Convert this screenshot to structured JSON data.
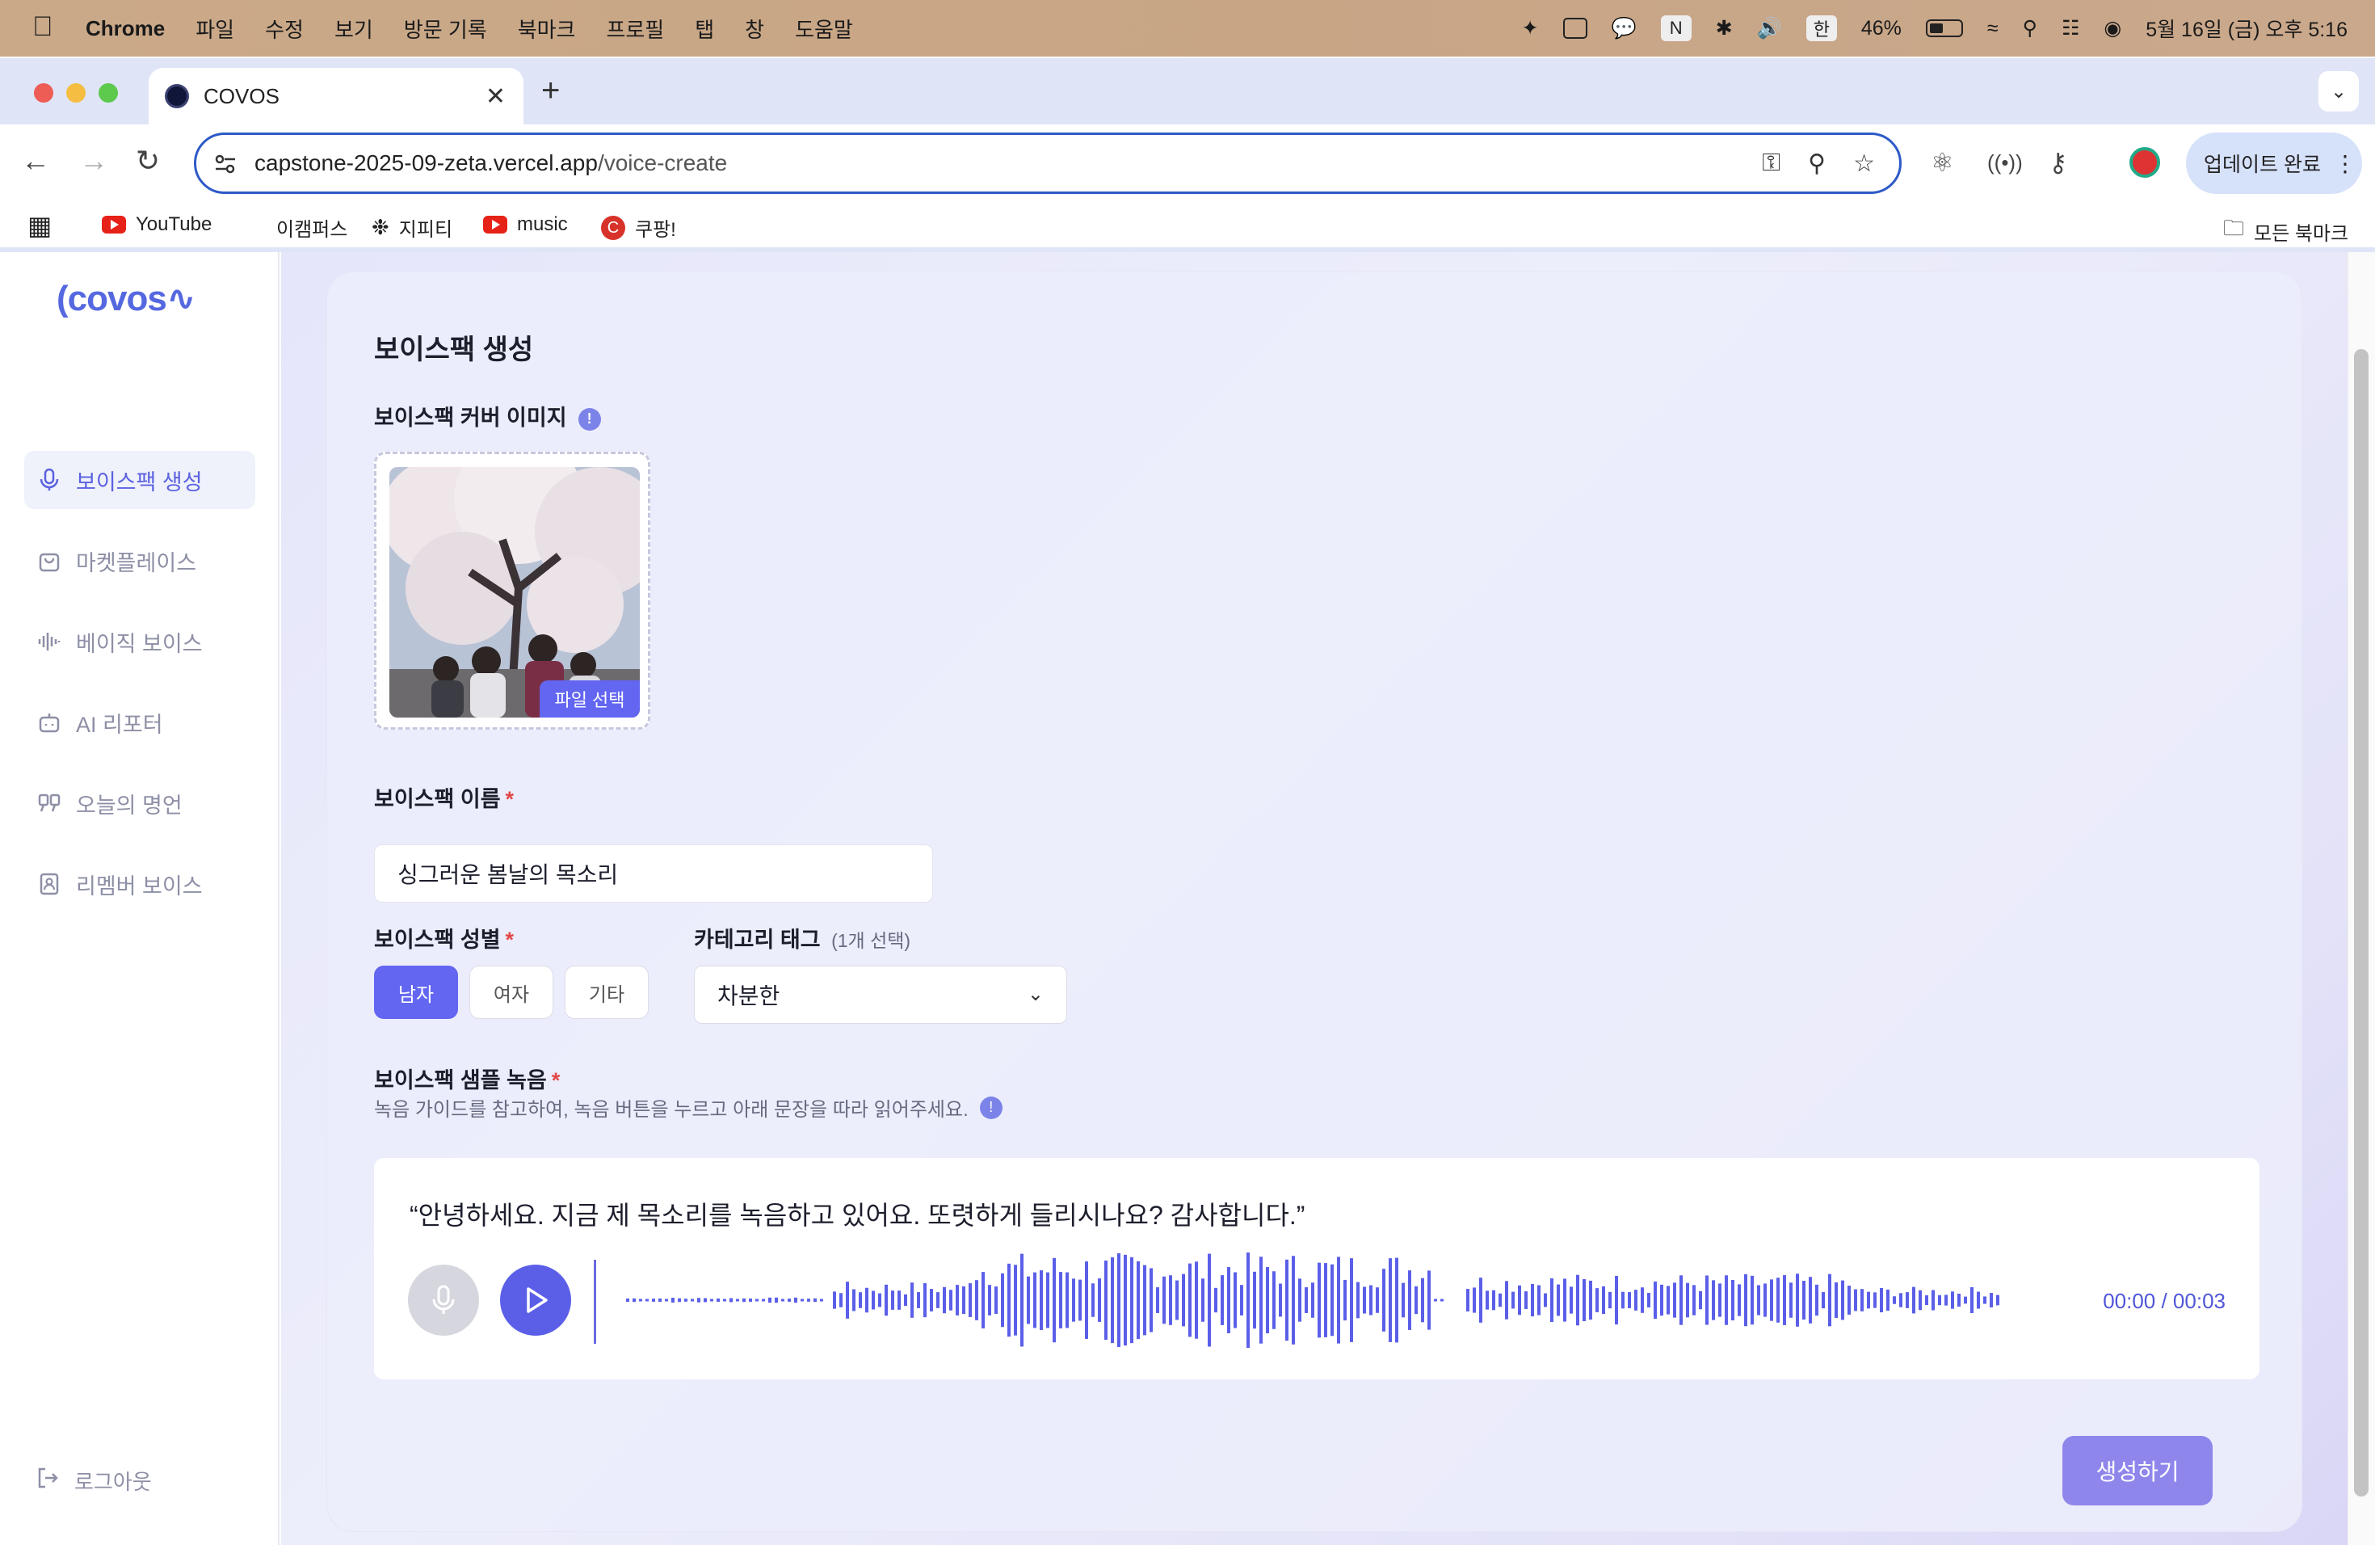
{
  "menubar": {
    "app": "Chrome",
    "items": [
      "파일",
      "수정",
      "보기",
      "방문 기록",
      "북마크",
      "프로필",
      "탭",
      "창",
      "도움말"
    ],
    "input_method": "한",
    "battery": "46%",
    "datetime": "5월 16일 (금) 오후 5:16"
  },
  "browser": {
    "tab_title": "COVOS",
    "url_host": "capstone-2025-09-zeta.vercel.app",
    "url_path": "/voice-create",
    "update_label": "업데이트 완료",
    "bookmarks": [
      "YouTube",
      "이캠퍼스",
      "지피티",
      "music",
      "쿠팡!"
    ],
    "all_bookmarks": "모든 북마크"
  },
  "sidebar": {
    "logo": "covos",
    "items": [
      {
        "label": "보이스팩 생성",
        "icon": "mic-icon"
      },
      {
        "label": "마켓플레이스",
        "icon": "bag-icon"
      },
      {
        "label": "베이직 보이스",
        "icon": "waveform-icon"
      },
      {
        "label": "AI 리포터",
        "icon": "robot-icon"
      },
      {
        "label": "오늘의 명언",
        "icon": "quote-icon"
      },
      {
        "label": "리멤버 보이스",
        "icon": "contact-icon"
      }
    ],
    "logout": "로그아웃"
  },
  "form": {
    "title": "보이스팩 생성",
    "cover_label": "보이스팩 커버 이미지",
    "file_button": "파일 선택",
    "name_label": "보이스팩 이름",
    "name_value": "싱그러운 봄날의 목소리",
    "gender_label": "보이스팩 성별",
    "gender_options": [
      "남자",
      "여자",
      "기타"
    ],
    "gender_selected": "남자",
    "category_label": "카테고리 태그",
    "category_hint": "(1개 선택)",
    "category_value": "차분한",
    "sample_label": "보이스팩 샘플 녹음",
    "sample_help": "녹음 가이드를 참고하여, 녹음 버튼을 누르고 아래 문장을 따라 읽어주세요.",
    "sentence": "“안녕하세요. 지금 제 목소리를 녹음하고 있어요. 또렷하게 들리시나요? 감사합니다.”",
    "time": "00:00 / 00:03",
    "submit": "생성하기"
  },
  "colors": {
    "accent": "#6366f1",
    "submit": "#8f86ec",
    "muted": "#8d8fa6"
  }
}
